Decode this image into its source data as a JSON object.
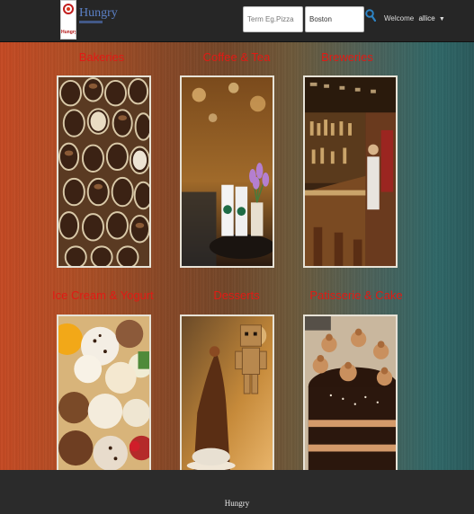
{
  "header": {
    "logo_text": "Hungry",
    "brand": "Hungry",
    "search": {
      "term_placeholder": "Term Eg.Pizza",
      "location_value": "Boston"
    },
    "welcome_label": "Welcome",
    "username": "allice"
  },
  "categories": [
    {
      "title": "Bakeries"
    },
    {
      "title": "Coffee & Tea"
    },
    {
      "title": "Breweries"
    },
    {
      "title": "Ice Cream & Yogurt"
    },
    {
      "title": "Desserts"
    },
    {
      "title": "Patisserie & Cake"
    }
  ],
  "footer": {
    "text": "Hungry"
  }
}
